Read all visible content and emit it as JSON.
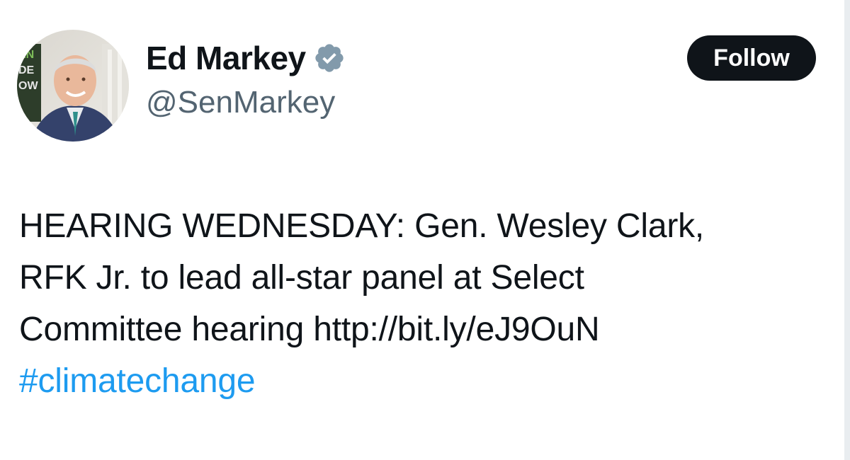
{
  "author": {
    "display_name": "Ed Markey",
    "handle": "@SenMarkey",
    "avatar_icon": "avatar-photo",
    "verified_icon": "verified-badge-icon",
    "verified_color": "#829aab"
  },
  "follow_button": {
    "label": "Follow"
  },
  "tweet": {
    "line1": "HEARING WEDNESDAY: Gen. Wesley Clark,",
    "line2": "RFK Jr. to lead all-star panel at Select",
    "line3_prefix": "Committee hearing ",
    "link": "http://bit.ly/eJ9OuN",
    "hashtag": "#climatechange"
  },
  "colors": {
    "text": "#0f1419",
    "secondary": "#536471",
    "hashtag": "#1d9bf0",
    "button_bg": "#0f1419"
  }
}
